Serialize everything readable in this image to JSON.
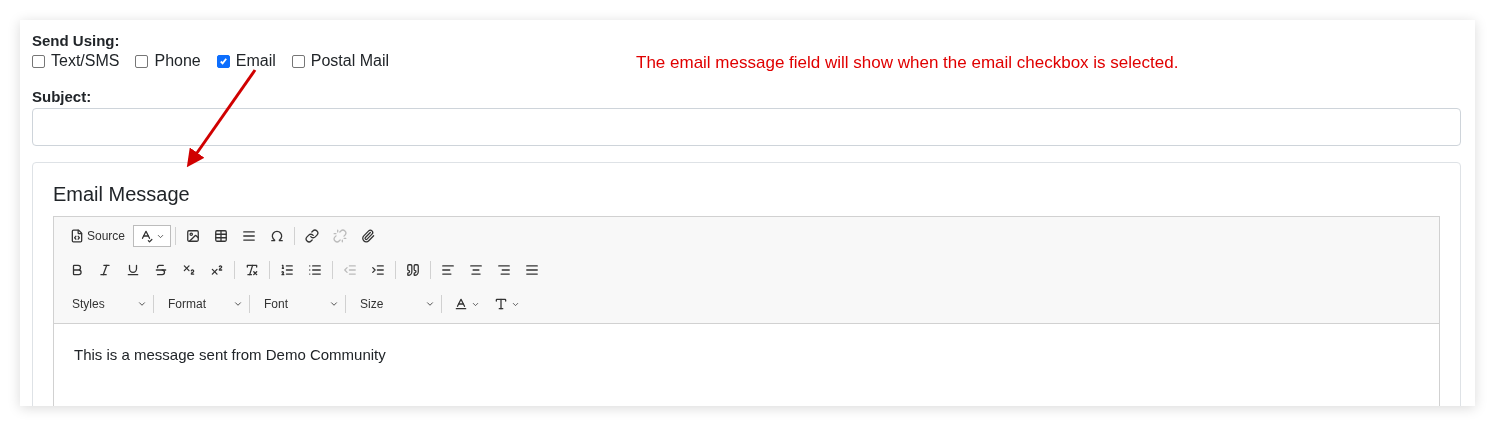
{
  "send_using": {
    "label": "Send Using:",
    "options": [
      {
        "label": "Text/SMS",
        "checked": false
      },
      {
        "label": "Phone",
        "checked": false
      },
      {
        "label": "Email",
        "checked": true
      },
      {
        "label": "Postal Mail",
        "checked": false
      }
    ]
  },
  "annotation": {
    "text": "The email message field will show when the email checkbox is selected."
  },
  "subject": {
    "label": "Subject:"
  },
  "email_message": {
    "title": "Email Message",
    "toolbar": [
      [
        {
          "kind": "source",
          "label": "Source",
          "disabled": false,
          "active": false
        },
        {
          "kind": "spellcheck",
          "disabled": false,
          "active": true
        },
        {
          "kind": "sep"
        },
        {
          "kind": "image",
          "disabled": false,
          "active": false
        },
        {
          "kind": "table",
          "disabled": false,
          "active": false
        },
        {
          "kind": "rule",
          "disabled": false,
          "active": false
        },
        {
          "kind": "omega",
          "disabled": false,
          "active": false
        },
        {
          "kind": "sep"
        },
        {
          "kind": "link",
          "disabled": false,
          "active": false
        },
        {
          "kind": "unlink",
          "disabled": true,
          "active": false
        },
        {
          "kind": "attach",
          "disabled": false,
          "active": false
        }
      ],
      [
        {
          "kind": "bold",
          "disabled": false,
          "active": false
        },
        {
          "kind": "italic",
          "disabled": false,
          "active": false
        },
        {
          "kind": "underline",
          "disabled": false,
          "active": false
        },
        {
          "kind": "strike",
          "disabled": false,
          "active": false
        },
        {
          "kind": "subscript",
          "disabled": false,
          "active": false
        },
        {
          "kind": "superscript",
          "disabled": false,
          "active": false
        },
        {
          "kind": "sep"
        },
        {
          "kind": "clear",
          "disabled": false,
          "active": false
        },
        {
          "kind": "sep"
        },
        {
          "kind": "ol",
          "disabled": false,
          "active": false
        },
        {
          "kind": "ul",
          "disabled": false,
          "active": false
        },
        {
          "kind": "sep"
        },
        {
          "kind": "outdent",
          "disabled": true,
          "active": false
        },
        {
          "kind": "indent",
          "disabled": false,
          "active": false
        },
        {
          "kind": "sep"
        },
        {
          "kind": "quote",
          "disabled": false,
          "active": false
        },
        {
          "kind": "sep"
        },
        {
          "kind": "left",
          "disabled": false,
          "active": false
        },
        {
          "kind": "center",
          "disabled": false,
          "active": false
        },
        {
          "kind": "right",
          "disabled": false,
          "active": false
        },
        {
          "kind": "justify",
          "disabled": false,
          "active": false
        }
      ],
      [
        {
          "kind": "combo",
          "label": "Styles"
        },
        {
          "kind": "combo",
          "label": "Format"
        },
        {
          "kind": "combo",
          "label": "Font"
        },
        {
          "kind": "combo",
          "label": "Size"
        },
        {
          "kind": "textcolor",
          "disabled": false,
          "active": false
        },
        {
          "kind": "bgcolor",
          "disabled": false,
          "active": false
        }
      ]
    ],
    "body": "This is a message sent from Demo Community"
  }
}
